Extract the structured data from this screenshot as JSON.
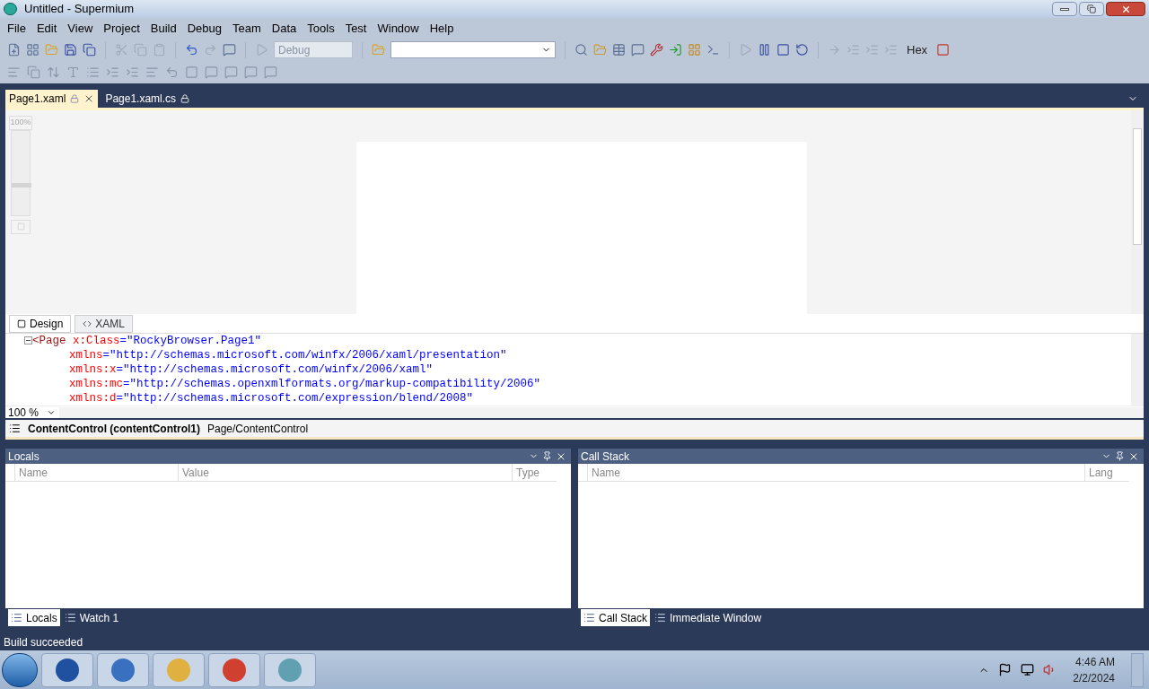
{
  "window": {
    "title": "Untitled - Supermium"
  },
  "menu": [
    "File",
    "Edit",
    "View",
    "Project",
    "Build",
    "Debug",
    "Team",
    "Data",
    "Tools",
    "Test",
    "Window",
    "Help"
  ],
  "toolbar": {
    "configuration": {
      "value": "Debug",
      "disabled": true
    },
    "find_box": {
      "kind": "combo"
    },
    "hex_button": {
      "label": "Hex",
      "selected": false
    }
  },
  "document_tabs": [
    {
      "label": "Page1.xaml",
      "selected": true,
      "locked": true
    },
    {
      "label": "Page1.xaml.cs",
      "selected": false,
      "locked": true
    }
  ],
  "designer": {
    "zoom_label": "100%",
    "zoom_slider": {
      "level": 0.35
    }
  },
  "view_tabs": [
    {
      "label": "Design",
      "selected": true
    },
    {
      "label": "XAML",
      "selected": false
    }
  ],
  "xaml_lines": [
    [
      {
        "kind": "tag",
        "text": "<Page"
      },
      {
        "kind": "attr",
        "text": " x:Class"
      },
      {
        "kind": "value",
        "text": "=\"RockyBrowser.Page1\""
      }
    ],
    [
      {
        "kind": "attr",
        "text": "xmlns"
      },
      {
        "kind": "value",
        "text": "=\"http://schemas.microsoft.com/winfx/2006/xaml/presentation\""
      }
    ],
    [
      {
        "kind": "attr",
        "text": "xmlns:x"
      },
      {
        "kind": "value",
        "text": "=\"http://schemas.microsoft.com/winfx/2006/xaml\""
      }
    ],
    [
      {
        "kind": "attr",
        "text": "xmlns:mc"
      },
      {
        "kind": "value",
        "text": "=\"http://schemas.openxmlformats.org/markup-compatibility/2006\""
      }
    ],
    [
      {
        "kind": "attr",
        "text": "xmlns:d"
      },
      {
        "kind": "value",
        "text": "=\"http://schemas.microsoft.com/expression/blend/2008\""
      }
    ]
  ],
  "editor_zoom": "100 %",
  "breadcrumb": {
    "element": "ContentControl (contentControl1)",
    "path": "Page/ContentControl"
  },
  "panels": [
    {
      "title": "Locals",
      "columns": [
        "Name",
        "Value",
        "Type"
      ],
      "tabs": [
        {
          "label": "Locals",
          "selected": true
        },
        {
          "label": "Watch 1",
          "selected": false
        }
      ]
    },
    {
      "title": "Call Stack",
      "columns": [
        "Name",
        "Lang"
      ],
      "tabs": [
        {
          "label": "Call Stack",
          "selected": true
        },
        {
          "label": "Immediate Window",
          "selected": false
        }
      ]
    }
  ],
  "status_bar": "Build succeeded",
  "taskbar": {
    "time": "4:46 AM",
    "date": "2/2/2024"
  }
}
